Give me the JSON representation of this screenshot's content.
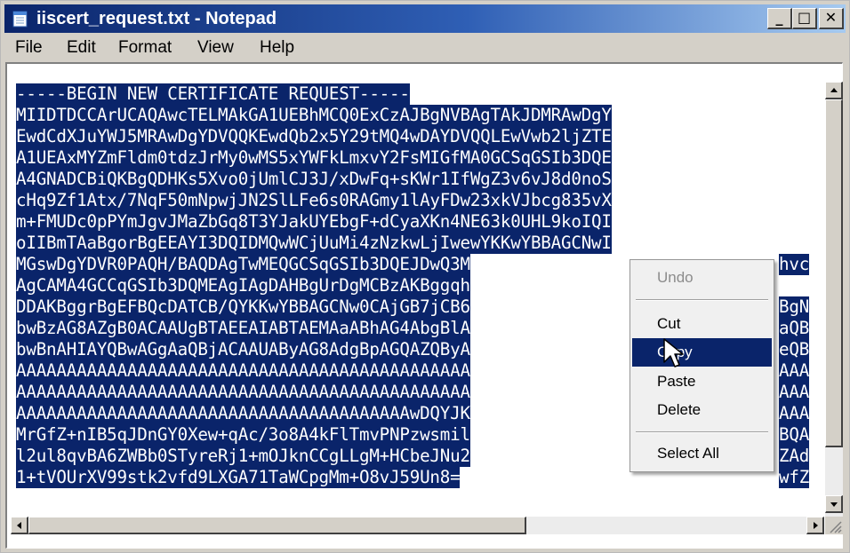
{
  "window": {
    "title": "iiscert_request.txt - Notepad",
    "icon": "notepad-icon",
    "controls": {
      "minimize": "_",
      "maximize": "□",
      "close": "✕"
    }
  },
  "menubar": {
    "items": [
      {
        "label": "File"
      },
      {
        "label": "Edit"
      },
      {
        "label": "Format"
      },
      {
        "label": "View"
      },
      {
        "label": "Help"
      }
    ]
  },
  "editor": {
    "lines": [
      "-----BEGIN NEW CERTIFICATE REQUEST-----",
      "MIIDTDCCArUCAQAwcTELMAkGA1UEBhMCQ0ExCzAJBgNVBAgTAkJDMRAwDgY",
      "EwdCdXJuYWJ5MRAwDgYDVQQKEwdQb2x5Y29tMQ4wDAYDVQQLEwVwb2ljZTE",
      "A1UEAxMYZmFldm0tdzJrMy0wMS5xYWFkLmxvY2FsMIGfMA0GCSqGSIb3DQE",
      "A4GNADCBiQKBgQDHKs5Xvo0jUmlCJ3J/xDwFq+sKWr1IfWgZ3v6vJ8d0noS",
      "cHq9Zf1Atx/7NqF50mNpwjJN2SlLFe6s0RAGmy1lAyFDw23xkVJbcg835vX",
      "m+FMUDc0pPYmJgvJMaZbGq8T3YJakUYEbgF+dCyaXKn4NE63k0UHL9koIQI",
      "oIIBmTAaBgorBgEEAYI3DQIDMQwWCjUuMi4zNzkwLjIwewYKKwYBBAGCNwI",
      "MGswDgYDVR0PAQH/BAQDAgTwMEQGCSqGSIb3DQEJDwQ3M",
      "AgCAMA4GCCqGSIb3DQMEAgIAgDAHBgUrDgMCBzAKBggqh",
      "DDAKBggrBgEFBQcDATCB/QYKKwYBBAGCNw0CAjGB7jCB6",
      "bwBzAG8AZgB0ACAAUgBTAEEAIABTAEMAaABhAG4AbgBlA",
      "bwBnAHIAYQBwAGgAaQBjACAAUAByAG8AdgBpAGQAZQByA",
      "AAAAAAAAAAAAAAAAAAAAAAAAAAAAAAAAAAAAAAAAAAAAA",
      "AAAAAAAAAAAAAAAAAAAAAAAAAAAAAAAAAAAAAAAAAAAAA",
      "AAAAAAAAAAAAAAAAAAAAAAAAAAAAAAAAAAAAAAAwDQYJK",
      "MrGfZ+nIB5qJDnGY0Xew+qAc/3o8A4kFlTmvPNPzwsmil",
      "l2ul8qvBA6ZWBb0STyreRj1+mOJknCCgLLgM+HCbeJNu2",
      "1+tVOUrXV99stk2vfd9LXGA71TaWCpgMm+O8vJ59Un8="
    ],
    "hidden_right": [
      "hvc",
      "BgN",
      "aQB",
      "eQB",
      "AAA",
      "AAA",
      "AAA",
      "BQA",
      "ZAd",
      "wfZ"
    ]
  },
  "context_menu": {
    "items": [
      {
        "label": "Undo",
        "state": "disabled"
      },
      {
        "label": "Cut",
        "state": "normal"
      },
      {
        "label": "Copy",
        "state": "highlighted"
      },
      {
        "label": "Paste",
        "state": "normal"
      },
      {
        "label": "Delete",
        "state": "normal"
      },
      {
        "label": "Select All",
        "state": "normal"
      }
    ]
  },
  "colors": {
    "selection": "#0a246a",
    "title_start": "#0a246a",
    "title_end": "#a6caf0",
    "chrome": "#d4d0c8",
    "menu_bg": "#f0f0f0"
  }
}
